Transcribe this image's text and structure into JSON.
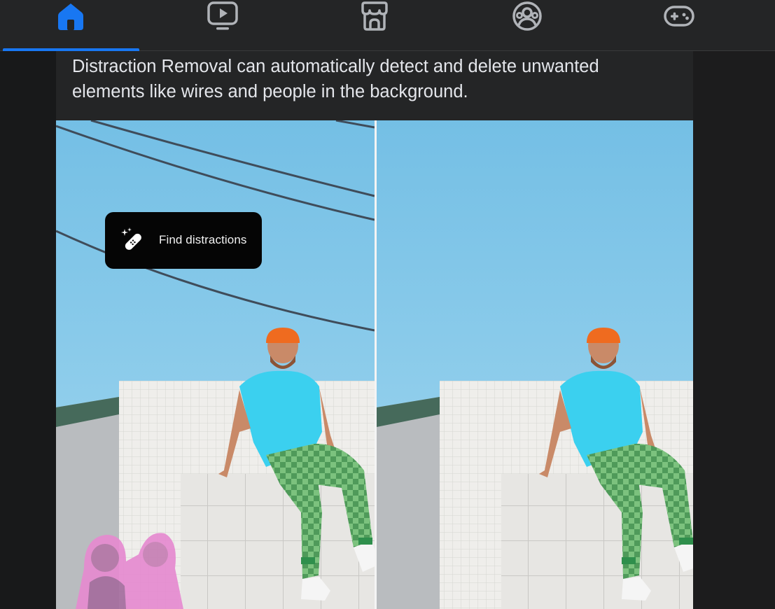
{
  "nav": {
    "tabs": [
      {
        "name": "home",
        "icon": "home-icon",
        "active": true
      },
      {
        "name": "video",
        "icon": "video-icon",
        "active": false
      },
      {
        "name": "marketplace",
        "icon": "marketplace-icon",
        "active": false
      },
      {
        "name": "groups",
        "icon": "groups-icon",
        "active": false
      },
      {
        "name": "gaming",
        "icon": "gaming-icon",
        "active": false
      }
    ],
    "active_color": "#1877f2",
    "inactive_color": "#b0b3b8"
  },
  "post": {
    "text": "Distraction Removal can automatically detect and delete unwanted elements like wires and people in the background.",
    "media": {
      "pill_label": "Find distractions",
      "pill_icon": "magic-bandage-icon",
      "left_panel": "before",
      "right_panel": "after"
    }
  }
}
